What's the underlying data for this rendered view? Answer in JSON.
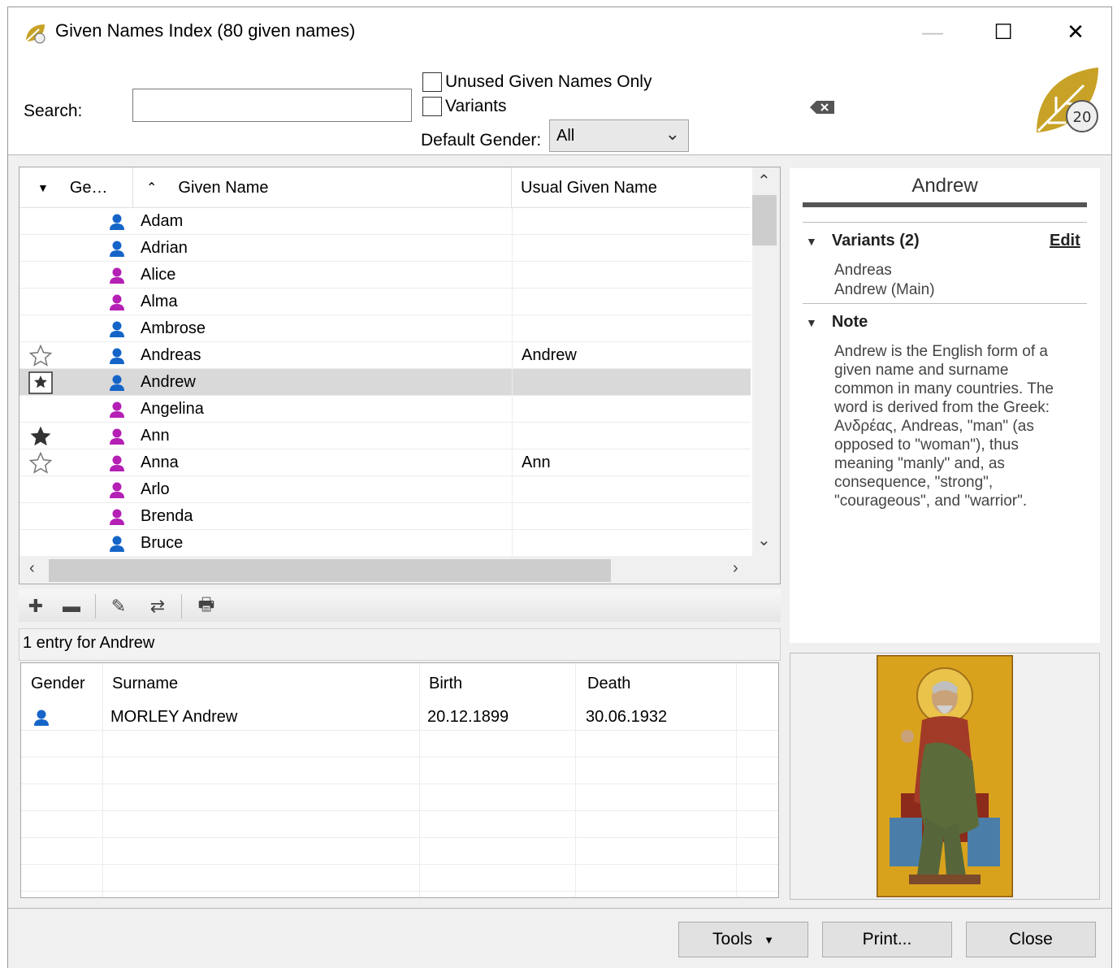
{
  "window": {
    "title": "Given Names Index (80 given names)",
    "minimize_glyph": "—",
    "maximize_glyph": "☐",
    "close_glyph": "✕"
  },
  "filters": {
    "search_label": "Search:",
    "search_value": "",
    "unused_only_label": "Unused Given Names Only",
    "unused_only_checked": false,
    "variants_label": "Variants",
    "variants_checked": false,
    "default_gender_label": "Default Gender:",
    "default_gender_value": "All"
  },
  "grid": {
    "columns": [
      "Ge…",
      "Given Name",
      "Usual Given Name"
    ],
    "rows": [
      {
        "star": "",
        "gender": "male",
        "name": "Adam",
        "usual": ""
      },
      {
        "star": "",
        "gender": "male",
        "name": "Adrian",
        "usual": ""
      },
      {
        "star": "",
        "gender": "female",
        "name": "Alice",
        "usual": ""
      },
      {
        "star": "",
        "gender": "female",
        "name": "Alma",
        "usual": ""
      },
      {
        "star": "",
        "gender": "male",
        "name": "Ambrose",
        "usual": ""
      },
      {
        "star": "outline",
        "gender": "male",
        "name": "Andreas",
        "usual": "Andrew"
      },
      {
        "star": "boxed",
        "gender": "male",
        "name": "Andrew",
        "usual": "",
        "selected": true
      },
      {
        "star": "",
        "gender": "female",
        "name": "Angelina",
        "usual": ""
      },
      {
        "star": "filled",
        "gender": "female",
        "name": "Ann",
        "usual": ""
      },
      {
        "star": "outline",
        "gender": "female",
        "name": "Anna",
        "usual": "Ann"
      },
      {
        "star": "",
        "gender": "female",
        "name": "Arlo",
        "usual": ""
      },
      {
        "star": "",
        "gender": "female",
        "name": "Brenda",
        "usual": ""
      },
      {
        "star": "",
        "gender": "male",
        "name": "Bruce",
        "usual": ""
      }
    ]
  },
  "toolbar": {
    "icons": [
      "add-icon",
      "remove-icon",
      "edit-icon",
      "merge-icon",
      "print-icon"
    ]
  },
  "entries": {
    "summary": "1 entry for Andrew",
    "columns": [
      "Gender",
      "Surname",
      "Birth",
      "Death"
    ],
    "rows": [
      {
        "gender": "male",
        "surname": "MORLEY Andrew",
        "birth": "20.12.1899",
        "death": "30.06.1932"
      }
    ]
  },
  "detail": {
    "name": "Andrew",
    "variants_heading": "Variants (2)",
    "edit_label": "Edit",
    "variants": [
      "Andreas",
      "Andrew (Main)"
    ],
    "note_heading": "Note",
    "note_lines": [
      "Andrew is the English form of a",
      "given name and surname",
      "common in many countries. The",
      "word is derived from the Greek:",
      "Ανδρέας, Andreas, \"man\" (as",
      "opposed to \"woman\"), thus",
      "meaning \"manly\" and, as",
      "consequence, \"strong\",",
      "\"courageous\", and \"warrior\"."
    ]
  },
  "buttons": {
    "tools": "Tools",
    "print": "Print...",
    "close": "Close"
  },
  "colors": {
    "male": "#1565c8",
    "female": "#b41fb4",
    "selected_row": "#d9d9d9",
    "logo_gold": "#c8a227"
  }
}
